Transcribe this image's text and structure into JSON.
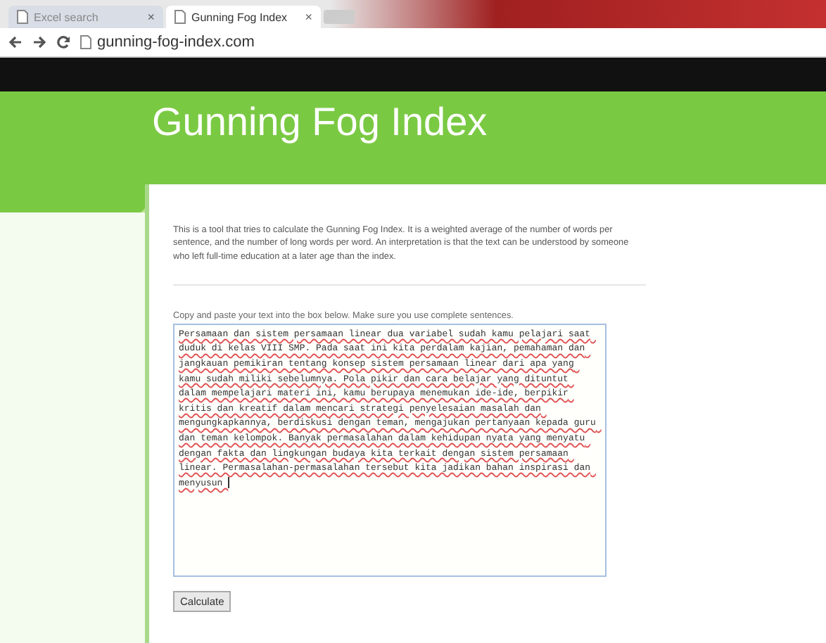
{
  "browser": {
    "tabs": [
      {
        "title": "Excel search",
        "selected": false
      },
      {
        "title": "Gunning Fog Index",
        "selected": true
      }
    ],
    "close_glyph": "×",
    "address": "gunning-fog-index.com"
  },
  "header": {
    "title": "Gunning Fog Index"
  },
  "intro": "This is a tool that tries to calculate the Gunning Fog Index. It is a weighted average of the number of words per sentence, and the number of long words per word. An interpretation is that the text can be understood by someone who left full-time education at a later age than the index.",
  "form": {
    "label": "Copy and paste your text into the box below. Make sure you use complete sentences.",
    "value": "Persamaan dan sistem persamaan linear dua variabel sudah kamu pelajari saat duduk di kelas VIII SMP. Pada saat ini kita perdalam kajian, pemahaman dan jangkauan pemikiran tentang konsep sistem persamaan linear dari apa yang kamu sudah miliki sebelumnya. Pola pikir dan cara belajar yang dituntut dalam mempelajari materi ini, kamu berupaya menemukan ide-ide, berpikir kritis dan kreatif dalam mencari strategi penyelesaian masalah dan mengungkapkannya, berdiskusi dengan teman, mengajukan pertanyaan kepada guru dan teman kelompok. Banyak permasalahan dalam kehidupan nyata yang menyatu dengan fakta dan lingkungan budaya kita terkait dengan sistem persamaan linear. Permasalahan-permasalahan tersebut kita jadikan bahan inspirasi dan menyusun ",
    "button": "Calculate"
  }
}
